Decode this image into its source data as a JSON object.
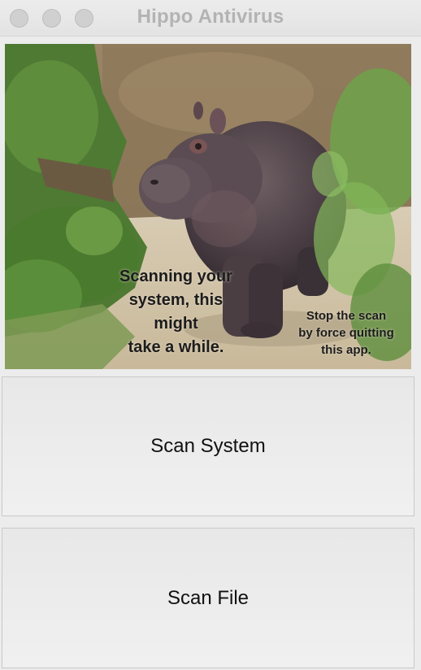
{
  "window": {
    "title": "Hippo Antivirus",
    "controls": [
      "close",
      "minimize",
      "zoom"
    ]
  },
  "image": {
    "subject": "hippo-photo",
    "caption_main": "Scanning your\nsystem, this\nmight\ntake a while.",
    "caption_stop": "Stop the scan\nby force quitting\nthis app."
  },
  "buttons": {
    "scan_system": "Scan System",
    "scan_file": "Scan File"
  },
  "colors": {
    "window_bg": "#ececec",
    "title_text": "#b3b3b3",
    "button_border": "#c9c9c9"
  }
}
